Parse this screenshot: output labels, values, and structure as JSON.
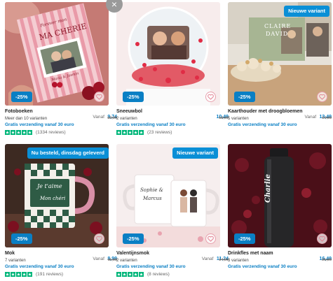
{
  "products": [
    {
      "title": "Fotoboeken",
      "price_prefix": "Vanaf",
      "price": "9,74",
      "old_price": "12,99",
      "variants": "Meer dan 10 varianten",
      "shipping": "Gratis verzending vanaf 30 euro",
      "reviews": "(1334 reviews)",
      "discount": "-25%",
      "book_title": "MA CHERIE",
      "book_subtitle": "Forever mon",
      "book_caption": "Maria & Jasmin"
    },
    {
      "title": "Sneeuwbol",
      "price_prefix": "",
      "price": "10,49",
      "old_price": "13,99",
      "variants": "2 varianten",
      "shipping": "Gratis verzending vanaf 30 euro",
      "reviews": "(23 reviews)",
      "discount": "-25%"
    },
    {
      "title": "Kaarthouder met droogbloemen",
      "price_prefix": "Vanaf",
      "price": "13,49",
      "old_price": "17,99",
      "variants": "5 varianten",
      "shipping": "Gratis verzending vanaf 30 euro",
      "reviews": "",
      "discount": "-25%",
      "badge": "Nieuwe variant",
      "card_text_1": "CLAIRE",
      "card_text_2": "DAVID"
    },
    {
      "title": "Mok",
      "price_prefix": "Vanaf",
      "price": "8,99",
      "old_price": "11,99",
      "variants": "7 varianten",
      "shipping": "Gratis verzending vanaf 30 euro",
      "reviews": "(191 reviews)",
      "discount": "-25%",
      "badge": "Nu besteld, dinsdag geleverd",
      "mug_text_1": "Je t'aime",
      "mug_text_2": "Mon chéri"
    },
    {
      "title": "Valentijnsmok",
      "price_prefix": "Vanaf",
      "price": "11,24",
      "old_price": "14,99",
      "variants": "2 varianten",
      "shipping": "Gratis verzending vanaf 30 euro",
      "reviews": "(8 reviews)",
      "discount": "-25%",
      "badge": "Nieuwe variant",
      "mug_text_1": "Sophie &",
      "mug_text_2": "Marcus"
    },
    {
      "title": "Drinkfles met naam",
      "price_prefix": "",
      "price": "16,49",
      "old_price": "21,99",
      "variants": "3 varianten",
      "shipping": "Gratis verzending vanaf 30 euro",
      "reviews": "",
      "discount": "-25%",
      "bottle_text": "Charlie"
    }
  ],
  "colors": {
    "accent": "#0a7fc4",
    "badge": "#0a8fd6",
    "trustpilot": "#00b67a"
  },
  "close_label": "×"
}
